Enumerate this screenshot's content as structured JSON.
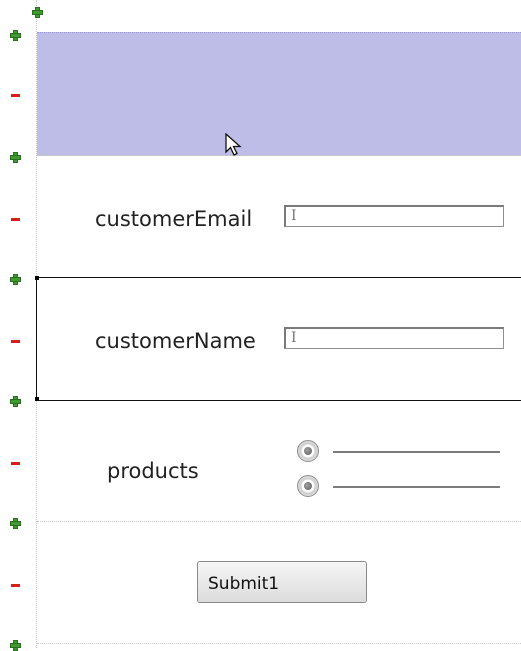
{
  "rows": [
    {
      "label": "",
      "kind": "header"
    },
    {
      "label": "customerEmail",
      "kind": "text-field",
      "value": ""
    },
    {
      "label": "customerName",
      "kind": "text-field",
      "value": ""
    },
    {
      "label": "products",
      "kind": "radio-group",
      "options": [
        "",
        ""
      ]
    },
    {
      "label": "",
      "kind": "button",
      "button_label": "Submit1"
    }
  ],
  "colors": {
    "selection": "#bdbde8",
    "add_marker": "#3f9a2f",
    "remove_marker": "#d5201c"
  },
  "icons": [
    "add-row-icon",
    "remove-row-icon",
    "radio-icon",
    "mouse-pointer-icon"
  ]
}
